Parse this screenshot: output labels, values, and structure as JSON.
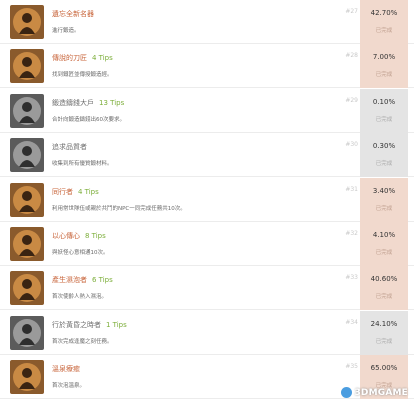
{
  "achievements": [
    {
      "title": "遺忘全新名器",
      "tips": "",
      "desc": "進行鍛造。",
      "num": "#27",
      "percent": "42.70%",
      "status": "已完成",
      "tier": "gold",
      "icon": "warrior-portrait-icon"
    },
    {
      "title": "傳說的刀匠",
      "tips": "4 Tips",
      "desc": "找到鐵匠並傳授鍛造經。",
      "num": "#28",
      "percent": "7.00%",
      "status": "已完成",
      "tier": "gold",
      "icon": "warrior-portrait-icon"
    },
    {
      "title": "鍛造鑄錢大戶",
      "tips": "13 Tips",
      "desc": "合計向鍛造鑄錢出60次要求。",
      "num": "#29",
      "percent": "0.10%",
      "status": "已完成",
      "tier": "silver",
      "icon": "warrior-portrait-icon"
    },
    {
      "title": "追求品質者",
      "tips": "",
      "desc": "收集到所有優質鍛材料。",
      "num": "#30",
      "percent": "0.30%",
      "status": "已完成",
      "tier": "silver",
      "icon": "warrior-portrait-icon"
    },
    {
      "title": "同行者",
      "tips": "4 Tips",
      "desc": "利用常世隊伍或親於共鬥的NPC一同完成任務共10次。",
      "num": "#31",
      "percent": "3.40%",
      "status": "已完成",
      "tier": "gold",
      "icon": "warrior-portrait-icon"
    },
    {
      "title": "以心傳心",
      "tips": "8 Tips",
      "desc": "與妖怪心意相通10次。",
      "num": "#32",
      "percent": "4.10%",
      "status": "已完成",
      "tier": "gold",
      "icon": "warrior-portrait-icon"
    },
    {
      "title": "產生濕泡者",
      "tips": "6 Tips",
      "desc": "首次使齡人熱入濕泡。",
      "num": "#33",
      "percent": "40.60%",
      "status": "已完成",
      "tier": "gold",
      "icon": "warrior-portrait-icon"
    },
    {
      "title": "行於黃昏之時者",
      "tips": "1 Tips",
      "desc": "首次完成逢魔之刻任務。",
      "num": "#34",
      "percent": "24.10%",
      "status": "已完成",
      "tier": "silver",
      "icon": "warrior-portrait-icon"
    },
    {
      "title": "溫泉療癒",
      "tips": "",
      "desc": "首次泡溫泉。",
      "num": "#35",
      "percent": "65.00%",
      "status": "已完成",
      "tier": "gold",
      "icon": "warrior-portrait-icon"
    }
  ],
  "watermark": "3DMGAME",
  "colors": {
    "gold_cell": "#f1d9cd",
    "silver_cell": "#e4e4e4",
    "gold_title": "#c8643a",
    "tips_green": "#7cae3a"
  }
}
